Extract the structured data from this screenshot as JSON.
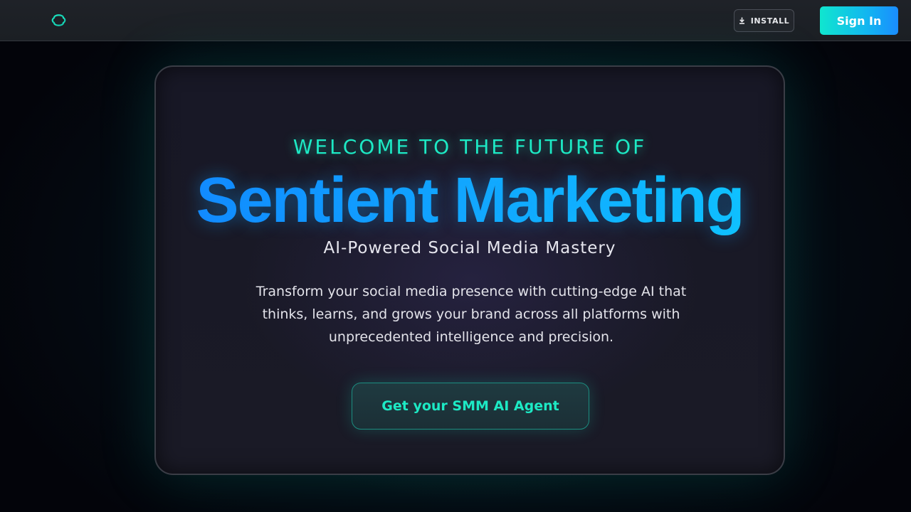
{
  "header": {
    "logo_icon": "sync-loop-logo-icon",
    "install": {
      "label": "INSTALL",
      "icon": "download-icon"
    },
    "sign_in_label": "Sign In"
  },
  "hero": {
    "eyebrow": "WELCOME TO THE FUTURE OF",
    "headline": "Sentient Marketing",
    "subhead": "AI-Powered Social Media Mastery",
    "description": "Transform your social media presence with cutting-edge AI that thinks, learns, and grows your brand across all platforms with unprecedented intelligence and precision.",
    "cta_label": "Get your SMM AI Agent"
  },
  "colors": {
    "accent_teal": "#1de9c4",
    "headline_blue_start": "#1287ff",
    "headline_blue_end": "#0fc9ff",
    "background": "#03040a",
    "card_background": "#181826"
  }
}
